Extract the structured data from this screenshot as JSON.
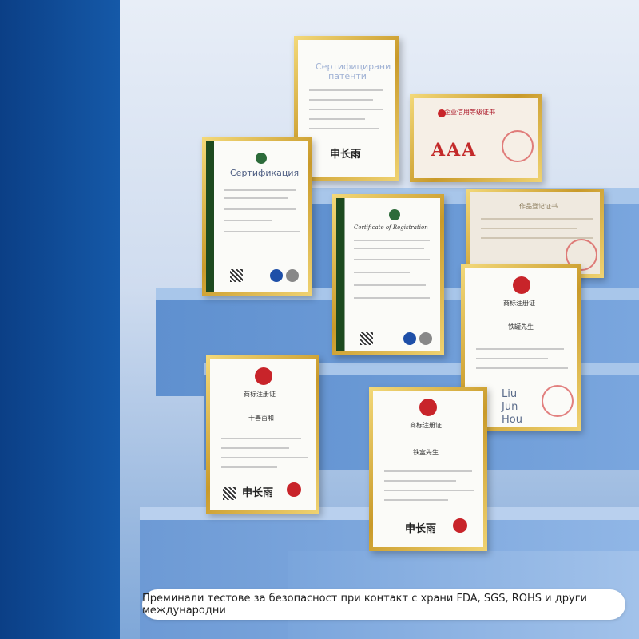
{
  "overlays": {
    "top_patent": "Сертифицирани патенти",
    "left_cert": "Сертификация",
    "liu_jun_hou": [
      "Liu",
      "Jun",
      "Hou"
    ]
  },
  "certificates": {
    "registration_title": "Certificate of Registration",
    "aaa": "AAA",
    "trademark_title": "商标注册证",
    "works_title": "作品登记证书",
    "credit_title": "企业信用等级证书",
    "trademark_name_1": "十善百和",
    "trademark_name_2": "铁盒先生",
    "trademark_name_3": "铁罐先生"
  },
  "caption": "Преминали тестове за безопасност при контакт с храни FDA, SGS, ROHS и други международни",
  "colors": {
    "left_panel": "#0b3f86",
    "frame_gold": "#c99a2a",
    "cert_green": "#1d4a1f",
    "seal_red": "#c8242a"
  }
}
